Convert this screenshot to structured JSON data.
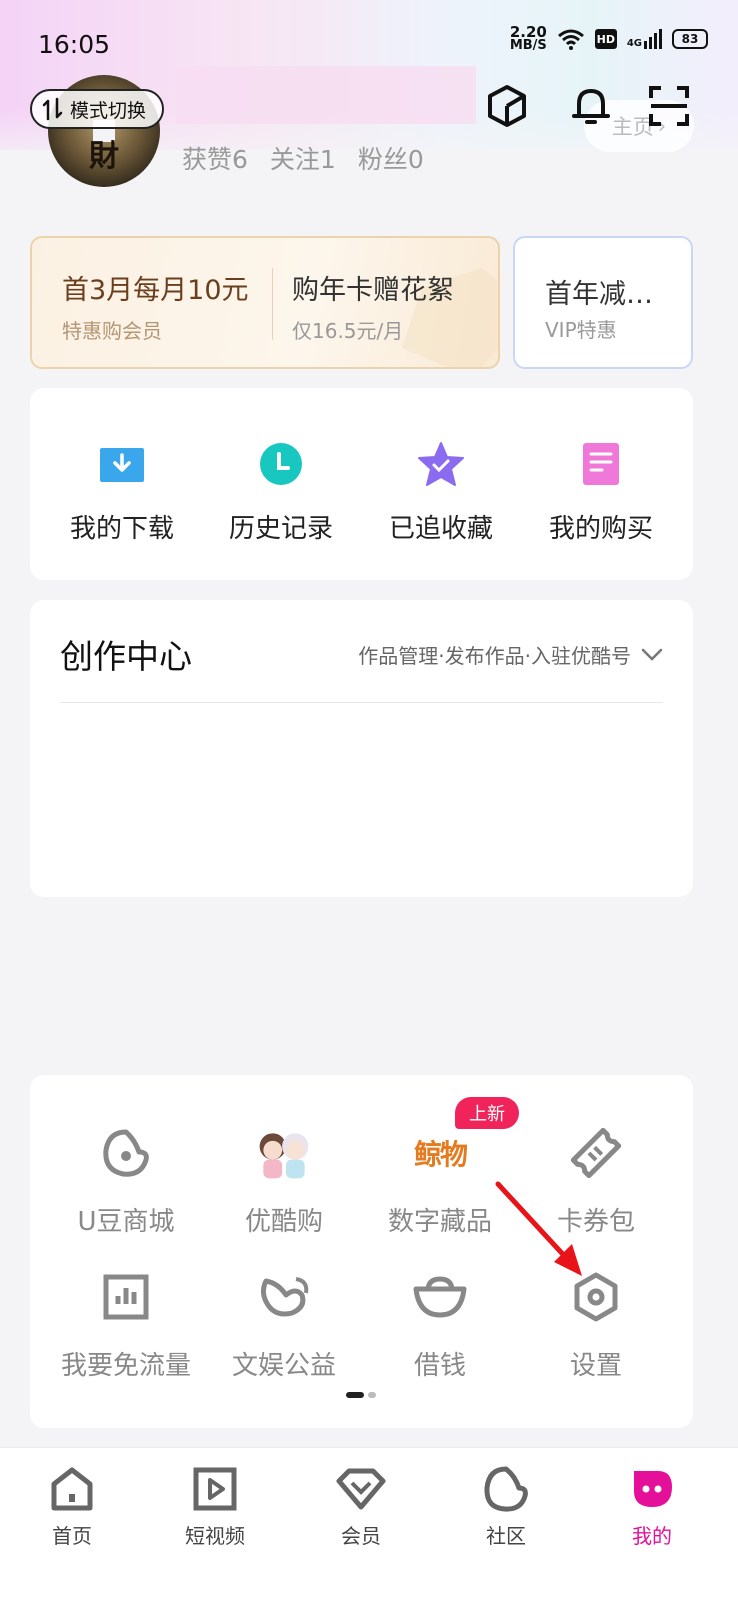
{
  "status_bar": {
    "time": "16:05",
    "net_speed_value": "2.20",
    "net_speed_unit": "MB/S",
    "hd": "HD",
    "signal": "4G",
    "battery": "83"
  },
  "profile": {
    "mode_switch": "模式切换",
    "stats": [
      "获赞6",
      "关注1",
      "粉丝0"
    ],
    "homepage_button": "主页",
    "avatar_char": "財"
  },
  "vip": {
    "offer1_title": "首3月每月10元",
    "offer1_sub": "特惠购会员",
    "offer2_title": "购年卡赠花絮",
    "offer2_sub": "仅16.5元/月",
    "side_title": "首年减…",
    "side_sub": "VIP特惠"
  },
  "quick_actions": [
    {
      "label": "我的下载",
      "icon": "download-icon"
    },
    {
      "label": "历史记录",
      "icon": "history-icon"
    },
    {
      "label": "已追收藏",
      "icon": "favorite-icon"
    },
    {
      "label": "我的购买",
      "icon": "purchase-icon"
    }
  ],
  "creator": {
    "title": "创作中心",
    "links": "作品管理·发布作品·入驻优酷号"
  },
  "services": {
    "badge": "上新",
    "items": [
      {
        "label": "U豆商城",
        "icon": "u-bean-icon"
      },
      {
        "label": "优酷购",
        "icon": "youku-shop-icon"
      },
      {
        "label": "数字藏品",
        "icon": "digital-collection-icon"
      },
      {
        "label": "卡券包",
        "icon": "coupon-icon"
      },
      {
        "label": "我要免流量",
        "icon": "free-data-icon"
      },
      {
        "label": "文娱公益",
        "icon": "charity-icon"
      },
      {
        "label": "借钱",
        "icon": "loan-icon"
      },
      {
        "label": "设置",
        "icon": "settings-icon"
      }
    ],
    "digital_logo_text": "鲸物"
  },
  "bottom_nav": [
    {
      "label": "首页",
      "icon": "home-icon"
    },
    {
      "label": "短视频",
      "icon": "short-video-icon"
    },
    {
      "label": "会员",
      "icon": "vip-icon"
    },
    {
      "label": "社区",
      "icon": "community-icon"
    },
    {
      "label": "我的",
      "icon": "profile-icon",
      "active": true
    }
  ],
  "colors": {
    "accent": "#e5109a",
    "badge_red": "#f0245a",
    "vip_gold": "#6b3f1d"
  }
}
